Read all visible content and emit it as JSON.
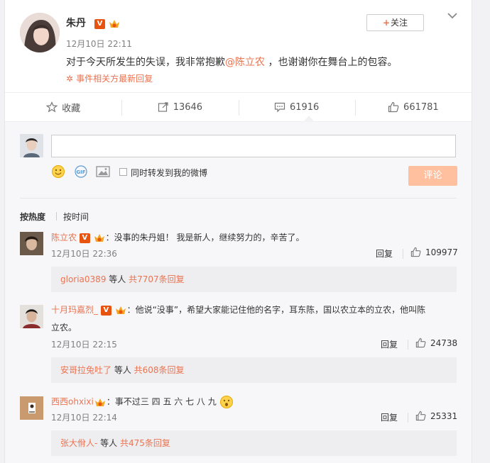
{
  "post": {
    "author": "朱丹",
    "time": "12月10日 22:11",
    "text_before": "对于今天所发生的失误，我非常抱歉",
    "mention": "@陈立农",
    "text_after": " ，也谢谢你在舞台上的包容。",
    "event_link": "事件相关方最新回复",
    "follow_label": "关注",
    "follow_plus": "+"
  },
  "actions": {
    "favorite": "收藏",
    "repost": "13646",
    "comment": "61916",
    "like": "661781"
  },
  "composer": {
    "repost_label": "同时转发到我的微博",
    "submit_label": "评论"
  },
  "sort": {
    "hot": "按热度",
    "time": "按时间"
  },
  "comments": [
    {
      "name": "陈立农",
      "text": "：没事的朱丹姐！ 我是新人，继续努力的，辛苦了。",
      "text2": "",
      "time": "12月10日 22:36",
      "reply": "回复",
      "likes": "109977",
      "sub_user": "gloria0389",
      "sub_mid": " 等人 ",
      "sub_count": "共7707条回复"
    },
    {
      "name": "十月玛嘉烈_",
      "text": "：他说“没事”，希望大家能记住他的名字，耳东陈，国以农立本的立农，他叫陈",
      "text2": "立农。",
      "time": "12月10日 22:15",
      "reply": "回复",
      "likes": "24738",
      "sub_user": "安哥拉兔吐了",
      "sub_mid": " 等人 ",
      "sub_count": "共608条回复"
    },
    {
      "name": "西西ohxixi",
      "text": "：事不过三 四 五 六 七 八 九",
      "text2": "",
      "time": "12月10日 22:14",
      "reply": "回复",
      "likes": "25331",
      "sub_user": "张大佾人-",
      "sub_mid": " 等人 ",
      "sub_count": "共475条回复"
    }
  ],
  "colors": {
    "accent": "#eb7350",
    "submit": "#ffc09f",
    "v_badge": "#e8540f"
  },
  "icons": [
    "star-icon",
    "repost-icon",
    "comment-icon",
    "thumbs-up-icon",
    "emoji-icon",
    "gif-icon",
    "image-icon",
    "flower-icon",
    "chevron-down-icon",
    "crown-badge-icon",
    "v-badge-icon",
    "surprised-emoji-icon"
  ]
}
